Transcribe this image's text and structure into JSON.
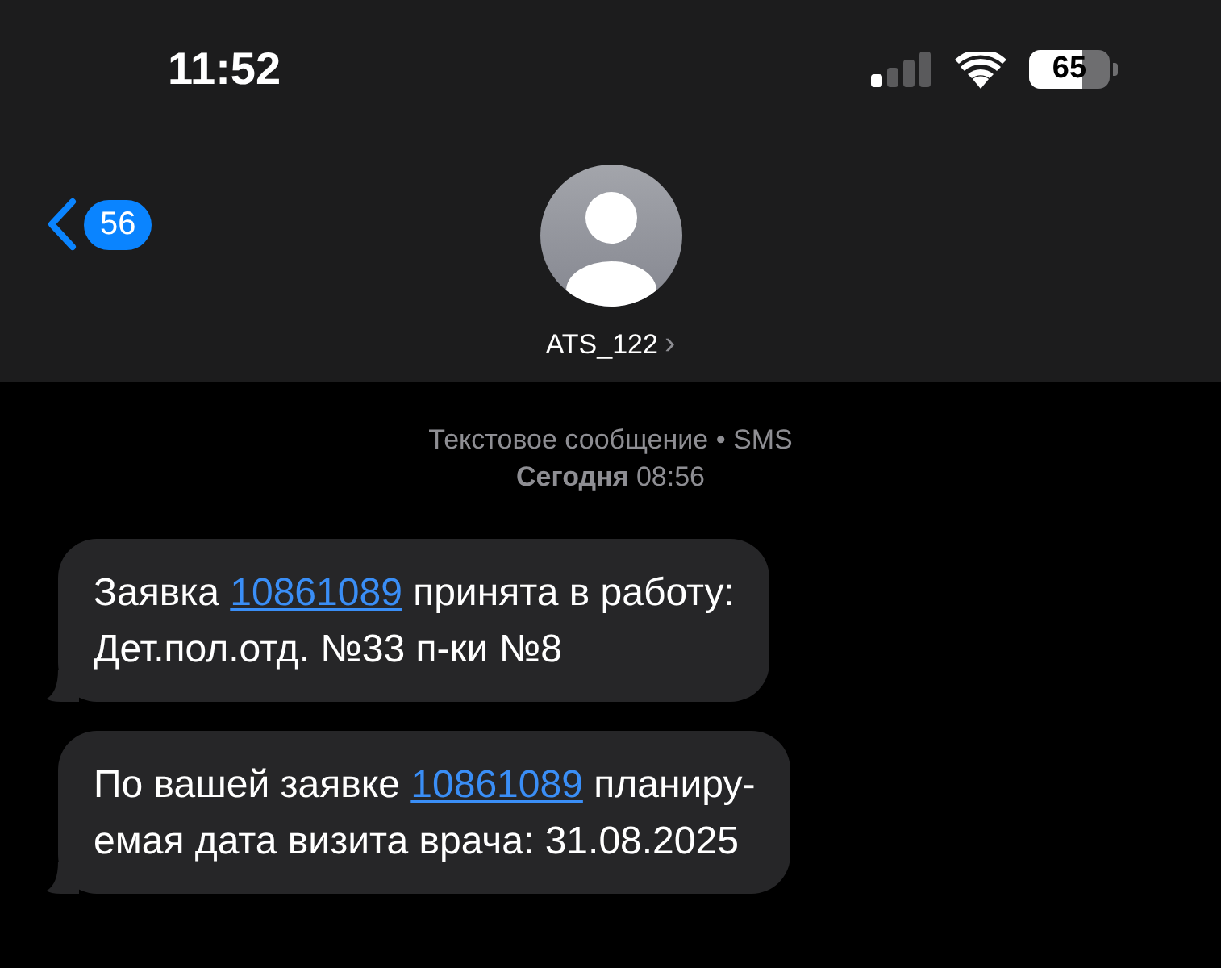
{
  "status_bar": {
    "time": "11:52",
    "battery": "65"
  },
  "header": {
    "back_count": "56",
    "contact": "ATS_122",
    "chevron": "›"
  },
  "meta": {
    "service": "Текстовое сообщение • SMS",
    "day": "Сегодня",
    "time": "08:56"
  },
  "messages": [
    {
      "parts": [
        {
          "kind": "text",
          "text": "Заявка "
        },
        {
          "kind": "link",
          "text": "10861089"
        },
        {
          "kind": "text",
          "text": " принята в работу:\nДет.пол.отд. №33 п-ки №8"
        }
      ]
    },
    {
      "parts": [
        {
          "kind": "text",
          "text": "По вашей заявке "
        },
        {
          "kind": "link",
          "text": "10861089"
        },
        {
          "kind": "text",
          "text": " планиру-\nемая дата визита врача: 31.08.2025"
        }
      ]
    }
  ]
}
